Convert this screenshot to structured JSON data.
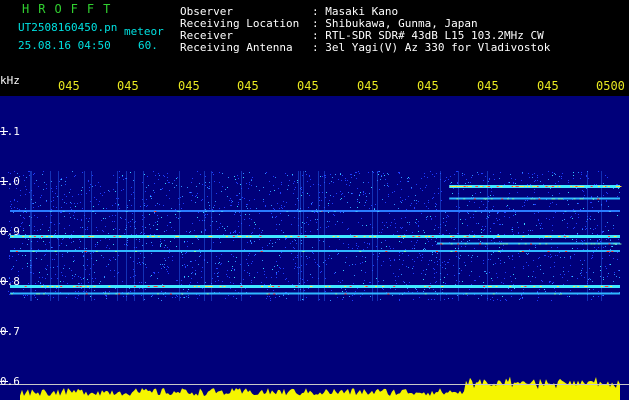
{
  "header": {
    "app_name": "HROFFT",
    "filename": "UT2508160450.pn",
    "mode": "meteor",
    "date_time": "25.08.16 04:50",
    "duration": "60.",
    "fields": [
      {
        "label": "Observer",
        "value": ": Masaki Kano"
      },
      {
        "label": "Receiving Location",
        "value": ": Shibukawa, Gunma, Japan"
      },
      {
        "label": "Receiver",
        "value": ": RTL-SDR SDR# 43dB L15 103.2MHz CW"
      },
      {
        "label": "Receiving Antenna",
        "value": ": 3el Yagi(V) Az 330 for Vladivostok"
      }
    ]
  },
  "colors": {
    "background": "#00007a",
    "text": "#ffffff",
    "header_accent": "#00e0e0",
    "time_labels": "#e8e820",
    "bottom_signal": "#f5f500"
  },
  "chart_data": {
    "type": "heatmap",
    "title": "",
    "xlabel": "",
    "ylabel": "kHz",
    "x_tick_labels": [
      "045",
      "045",
      "045",
      "045",
      "045",
      "045",
      "045",
      "045",
      "045",
      "0500"
    ],
    "y_tick_labels": [
      "1.1",
      "1.0",
      "0.9",
      "0.8",
      "0.7",
      "0.6"
    ],
    "y_ticks_khz": [
      1.1,
      1.0,
      0.9,
      0.8,
      0.7,
      0.6
    ],
    "ylim": [
      0.6,
      1.17
    ],
    "xlim_minutes": [
      0,
      10
    ],
    "grid": false,
    "horizontal_bands_khz": [
      {
        "freq": 0.99,
        "strength": "strong",
        "start_minute": 7.2
      },
      {
        "freq": 0.965,
        "strength": "medium",
        "start_minute": 7.2
      },
      {
        "freq": 0.94,
        "strength": "weak",
        "start_minute": 0
      },
      {
        "freq": 0.89,
        "strength": "strong",
        "start_minute": 0
      },
      {
        "freq": 0.875,
        "strength": "medium",
        "start_minute": 7.0
      },
      {
        "freq": 0.86,
        "strength": "medium",
        "start_minute": 0
      },
      {
        "freq": 0.79,
        "strength": "strong",
        "start_minute": 0
      },
      {
        "freq": 0.775,
        "strength": "medium",
        "start_minute": 0
      }
    ],
    "noise_region_khz": [
      0.76,
      1.02
    ],
    "bottom_signal_trace": "yellow amplitude trace along bottom edge"
  }
}
